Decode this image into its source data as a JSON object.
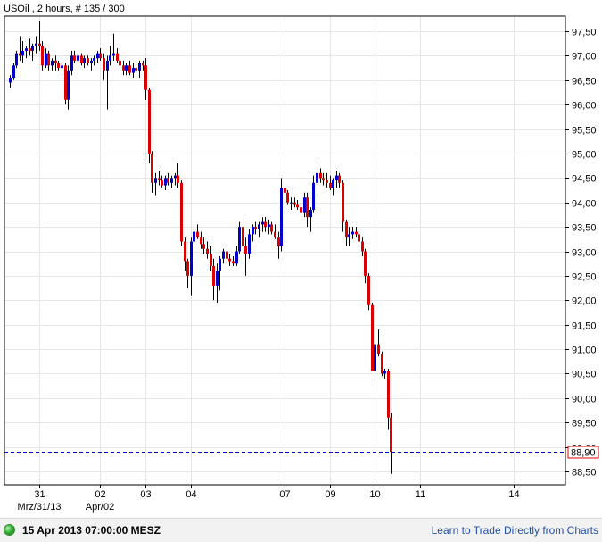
{
  "header": {
    "title": "USOil , 2 hours, # 135 / 300"
  },
  "footer": {
    "timestamp": "15 Apr 2013 07:00:00 MESZ",
    "link_text": "Learn to Trade Directly from Charts"
  },
  "colors": {
    "up_candle": "#0000cc",
    "down_candle": "#dd0000",
    "wick": "#000000",
    "grid": "#e6e6e6",
    "price_line": "#0000cc",
    "price_box_border": "#dd0000"
  },
  "chart_data": {
    "type": "candlestick",
    "title": "USOil , 2 hours, # 135 / 300",
    "ylim": [
      88.25,
      97.75
    ],
    "y_ticks": [
      "97,50",
      "97,00",
      "96,50",
      "96,00",
      "95,50",
      "95,00",
      "94,50",
      "94,00",
      "93,50",
      "93,00",
      "92,50",
      "92,00",
      "91,50",
      "91,00",
      "90,50",
      "90,00",
      "89,50",
      "89,00",
      "88,50"
    ],
    "x_ticks": [
      {
        "label": "31",
        "index": 9
      },
      {
        "label": "02",
        "index": 28
      },
      {
        "label": "03",
        "index": 42
      },
      {
        "label": "04",
        "index": 56
      },
      {
        "label": "07",
        "index": 85
      },
      {
        "label": "09",
        "index": 99
      },
      {
        "label": "10",
        "index": 113
      },
      {
        "label": "11",
        "index": 127
      },
      {
        "label": "14",
        "index": 156
      }
    ],
    "x_subticks": [
      {
        "label": "Mrz/31/13",
        "index": 9
      },
      {
        "label": "Apr/02",
        "index": 28
      }
    ],
    "current_price": 88.9,
    "current_price_label": "88,90",
    "candles": [
      [
        96.45,
        96.6,
        96.35,
        96.55
      ],
      [
        96.55,
        96.85,
        96.5,
        96.8
      ],
      [
        96.8,
        97.1,
        96.75,
        97.05
      ],
      [
        97.05,
        97.4,
        96.9,
        97.0
      ],
      [
        97.0,
        97.3,
        96.85,
        97.1
      ],
      [
        97.1,
        97.2,
        96.95,
        97.15
      ],
      [
        97.15,
        97.35,
        97.0,
        97.1
      ],
      [
        97.1,
        97.25,
        96.9,
        97.2
      ],
      [
        97.2,
        97.4,
        97.05,
        97.25
      ],
      [
        97.25,
        97.7,
        97.1,
        97.2
      ],
      [
        97.2,
        97.3,
        96.7,
        96.8
      ],
      [
        96.8,
        97.15,
        96.75,
        97.05
      ],
      [
        97.05,
        97.1,
        96.7,
        96.8
      ],
      [
        96.8,
        96.95,
        96.7,
        96.9
      ],
      [
        96.9,
        97.0,
        96.7,
        96.85
      ],
      [
        96.85,
        96.9,
        96.7,
        96.75
      ],
      [
        96.75,
        96.9,
        96.6,
        96.8
      ],
      [
        96.8,
        96.85,
        96.0,
        96.1
      ],
      [
        96.1,
        96.8,
        95.9,
        96.7
      ],
      [
        96.7,
        97.1,
        96.6,
        97.0
      ],
      [
        97.0,
        97.1,
        96.85,
        96.9
      ],
      [
        96.9,
        97.05,
        96.8,
        97.0
      ],
      [
        97.0,
        97.05,
        96.8,
        96.85
      ],
      [
        96.85,
        97.0,
        96.75,
        96.95
      ],
      [
        96.95,
        97.0,
        96.8,
        96.85
      ],
      [
        96.85,
        96.95,
        96.7,
        96.9
      ],
      [
        96.9,
        97.0,
        96.8,
        96.95
      ],
      [
        96.95,
        97.1,
        96.85,
        97.05
      ],
      [
        97.05,
        97.15,
        96.9,
        96.95
      ],
      [
        96.95,
        97.05,
        96.5,
        96.7
      ],
      [
        96.7,
        97.0,
        95.9,
        96.9
      ],
      [
        96.9,
        97.2,
        96.8,
        97.0
      ],
      [
        97.0,
        97.45,
        96.9,
        97.05
      ],
      [
        97.05,
        97.15,
        96.85,
        96.9
      ],
      [
        96.9,
        97.0,
        96.75,
        96.8
      ],
      [
        96.8,
        96.9,
        96.6,
        96.7
      ],
      [
        96.7,
        96.85,
        96.6,
        96.8
      ],
      [
        96.8,
        96.9,
        96.6,
        96.65
      ],
      [
        96.65,
        96.85,
        96.55,
        96.75
      ],
      [
        96.75,
        96.9,
        96.6,
        96.7
      ],
      [
        96.7,
        96.9,
        96.55,
        96.85
      ],
      [
        96.85,
        96.9,
        96.7,
        96.8
      ],
      [
        96.8,
        96.95,
        96.1,
        96.3
      ],
      [
        96.3,
        96.35,
        94.8,
        95.0
      ],
      [
        95.0,
        95.05,
        94.2,
        94.4
      ],
      [
        94.4,
        94.6,
        94.15,
        94.5
      ],
      [
        94.5,
        94.65,
        94.35,
        94.45
      ],
      [
        94.45,
        94.55,
        94.3,
        94.35
      ],
      [
        94.35,
        94.55,
        94.25,
        94.5
      ],
      [
        94.5,
        94.6,
        94.35,
        94.4
      ],
      [
        94.4,
        94.55,
        94.3,
        94.5
      ],
      [
        94.5,
        94.6,
        94.35,
        94.55
      ],
      [
        94.55,
        94.8,
        94.3,
        94.4
      ],
      [
        94.4,
        94.45,
        93.1,
        93.2
      ],
      [
        93.2,
        93.3,
        92.6,
        92.8
      ],
      [
        92.8,
        92.85,
        92.25,
        92.5
      ],
      [
        92.5,
        93.3,
        92.1,
        93.2
      ],
      [
        93.2,
        93.45,
        93.05,
        93.4
      ],
      [
        93.4,
        93.55,
        93.25,
        93.3
      ],
      [
        93.3,
        93.4,
        93.05,
        93.15
      ],
      [
        93.15,
        93.3,
        92.95,
        93.05
      ],
      [
        93.05,
        93.2,
        92.85,
        92.95
      ],
      [
        92.95,
        93.1,
        92.6,
        92.7
      ],
      [
        92.7,
        92.85,
        92.0,
        92.3
      ],
      [
        92.3,
        92.75,
        91.95,
        92.6
      ],
      [
        92.6,
        92.9,
        92.2,
        92.85
      ],
      [
        92.85,
        93.05,
        92.75,
        93.0
      ],
      [
        93.0,
        93.05,
        92.8,
        92.85
      ],
      [
        92.85,
        92.95,
        92.7,
        92.8
      ],
      [
        92.8,
        92.9,
        92.7,
        92.75
      ],
      [
        92.75,
        93.1,
        92.7,
        93.0
      ],
      [
        93.0,
        93.6,
        92.95,
        93.5
      ],
      [
        93.5,
        93.75,
        93.3,
        93.1
      ],
      [
        93.1,
        93.3,
        92.5,
        92.95
      ],
      [
        92.95,
        93.45,
        92.85,
        93.35
      ],
      [
        93.35,
        93.55,
        93.2,
        93.5
      ],
      [
        93.5,
        93.6,
        93.35,
        93.45
      ],
      [
        93.45,
        93.6,
        93.3,
        93.55
      ],
      [
        93.55,
        93.7,
        93.4,
        93.6
      ],
      [
        93.6,
        93.7,
        93.4,
        93.5
      ],
      [
        93.5,
        93.65,
        93.35,
        93.55
      ],
      [
        93.55,
        93.6,
        93.35,
        93.4
      ],
      [
        93.4,
        93.55,
        93.25,
        93.3
      ],
      [
        93.3,
        93.4,
        92.85,
        93.1
      ],
      [
        93.1,
        94.5,
        93.0,
        94.3
      ],
      [
        94.3,
        94.5,
        93.8,
        94.2
      ],
      [
        94.2,
        94.25,
        93.95,
        94.0
      ],
      [
        94.0,
        94.1,
        93.85,
        94.0
      ],
      [
        94.0,
        94.1,
        93.9,
        93.95
      ],
      [
        93.95,
        94.05,
        93.85,
        93.9
      ],
      [
        93.9,
        94.0,
        93.75,
        93.8
      ],
      [
        93.8,
        94.2,
        93.7,
        94.1
      ],
      [
        94.1,
        94.2,
        93.5,
        93.7
      ],
      [
        93.7,
        93.9,
        93.4,
        93.85
      ],
      [
        93.85,
        94.55,
        93.8,
        94.4
      ],
      [
        94.4,
        94.8,
        94.1,
        94.6
      ],
      [
        94.6,
        94.7,
        94.4,
        94.5
      ],
      [
        94.5,
        94.6,
        94.35,
        94.45
      ],
      [
        94.45,
        94.6,
        94.3,
        94.4
      ],
      [
        94.4,
        94.55,
        94.25,
        94.3
      ],
      [
        94.3,
        94.5,
        94.15,
        94.45
      ],
      [
        94.45,
        94.65,
        94.3,
        94.55
      ],
      [
        94.55,
        94.6,
        94.3,
        94.4
      ],
      [
        94.4,
        94.45,
        93.4,
        93.6
      ],
      [
        93.6,
        93.65,
        93.1,
        93.3
      ],
      [
        93.3,
        93.5,
        93.1,
        93.35
      ],
      [
        93.35,
        93.5,
        93.25,
        93.4
      ],
      [
        93.4,
        93.5,
        93.3,
        93.35
      ],
      [
        93.35,
        93.4,
        93.1,
        93.2
      ],
      [
        93.2,
        93.3,
        92.9,
        93.0
      ],
      [
        93.0,
        93.05,
        92.35,
        92.5
      ],
      [
        92.5,
        92.55,
        91.8,
        91.9
      ],
      [
        91.9,
        91.95,
        90.9,
        90.55
      ],
      [
        90.55,
        91.85,
        90.3,
        91.1
      ],
      [
        91.1,
        91.4,
        90.85,
        90.9
      ],
      [
        90.9,
        90.95,
        90.45,
        90.5
      ],
      [
        90.5,
        90.6,
        90.4,
        90.55
      ],
      [
        90.55,
        90.6,
        89.35,
        89.6
      ],
      [
        89.6,
        89.7,
        88.45,
        88.9
      ]
    ]
  }
}
